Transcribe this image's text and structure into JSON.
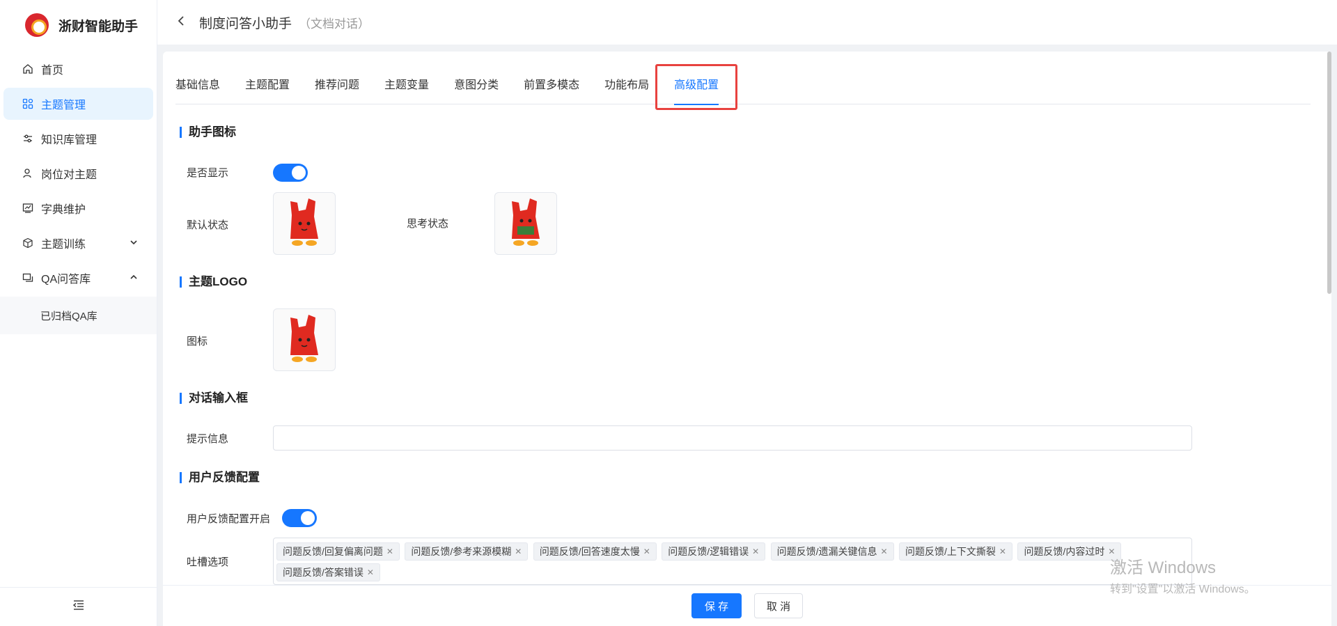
{
  "app": {
    "title": "浙财智能助手"
  },
  "sidebar": {
    "items": [
      {
        "label": "首页",
        "icon": "home-icon"
      },
      {
        "label": "主题管理",
        "icon": "grid-icon",
        "active": true
      },
      {
        "label": "知识库管理",
        "icon": "sliders-icon"
      },
      {
        "label": "岗位对主题",
        "icon": "user-icon"
      },
      {
        "label": "字典维护",
        "icon": "chart-icon"
      },
      {
        "label": "主题训练",
        "icon": "cube-icon",
        "chevron": "down"
      },
      {
        "label": "QA问答库",
        "icon": "chat-icon",
        "chevron": "up"
      }
    ],
    "sub_items": [
      {
        "label": "已归档QA库"
      }
    ]
  },
  "header": {
    "title": "制度问答小助手",
    "subtitle": "（文档对话）"
  },
  "tabs": [
    {
      "label": "基础信息"
    },
    {
      "label": "主题配置"
    },
    {
      "label": "推荐问题"
    },
    {
      "label": "主题变量"
    },
    {
      "label": "意图分类"
    },
    {
      "label": "前置多模态"
    },
    {
      "label": "功能布局"
    },
    {
      "label": "高级配置",
      "active": true
    }
  ],
  "sections": {
    "assistant_icon": {
      "title": "助手图标",
      "show_label": "是否显示",
      "show_value": true,
      "default_label": "默认状态",
      "thinking_label": "思考状态"
    },
    "theme_logo": {
      "title": "主题LOGO",
      "icon_label": "图标"
    },
    "input_box": {
      "title": "对话输入框",
      "hint_label": "提示信息",
      "hint_value": ""
    },
    "feedback": {
      "title": "用户反馈配置",
      "enable_label": "用户反馈配置开启",
      "enable_value": true,
      "options_label": "吐槽选项",
      "tags": [
        "问题反馈/回复偏离问题",
        "问题反馈/参考来源模糊",
        "问题反馈/回答速度太慢",
        "问题反馈/逻辑错误",
        "问题反馈/遗漏关键信息",
        "问题反馈/上下文撕裂",
        "问题反馈/内容过时",
        "问题反馈/答案错误"
      ]
    }
  },
  "footer": {
    "save_label": "保 存",
    "cancel_label": "取 消"
  },
  "watermark": {
    "line1": "激活 Windows",
    "line2": "转到\"设置\"以激活 Windows。"
  },
  "colors": {
    "accent": "#1677ff",
    "highlight": "#e8423f",
    "mascot": "#e02a20"
  }
}
